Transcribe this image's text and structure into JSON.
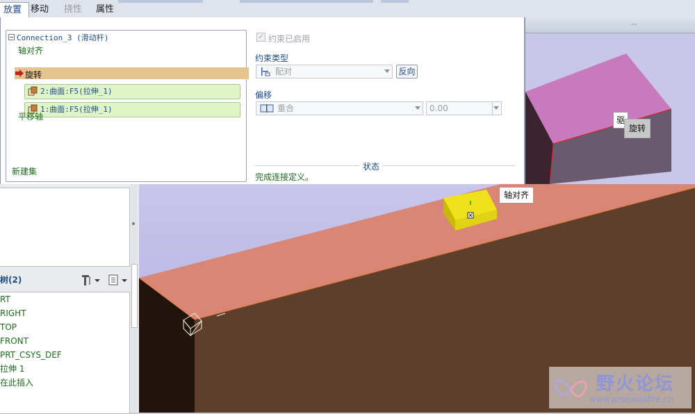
{
  "tabs": [
    {
      "label": "放置",
      "state": "active"
    },
    {
      "label": "移动",
      "state": "normal"
    },
    {
      "label": "挠性",
      "state": "disabled"
    },
    {
      "label": "属性",
      "state": "normal"
    }
  ],
  "sets": {
    "connection_title": "Connection_3 (滑动杆)",
    "items": [
      {
        "label": "轴对齐"
      },
      {
        "label": "旋转",
        "selected": true
      },
      {
        "label": "平移轴"
      }
    ],
    "references": [
      {
        "label": "2:曲面:F5(拉伸_1)"
      },
      {
        "label": "1:曲面:F5(拉伸_1)"
      }
    ],
    "new_set_label": "新建集"
  },
  "constraint": {
    "enabled_label": "约束已启用",
    "type_heading": "约束类型",
    "type_value": "配对",
    "flip_button": "反向",
    "offset_heading": "偏移",
    "offset_value": "重合",
    "offset_number": "0.00"
  },
  "status": {
    "heading": "状态",
    "message": "完成连接定义。"
  },
  "model_tree": {
    "section_title": "树(2)",
    "items": [
      "RT",
      "RIGHT",
      "TOP",
      "FRONT",
      "PRT_CSYS_DEF",
      "拉伸 1",
      "在此插入"
    ]
  },
  "viewport_labels": {
    "axis_align": "轴对齐",
    "rotate": "旋转",
    "preview_rotate": "旋转",
    "preview_partial": "驱"
  },
  "watermark": {
    "title": "野火论坛",
    "url": "www.proewildfire.cn"
  },
  "colors": {
    "beam_top": "#d98675",
    "beam_side": "#5e3f2c",
    "beam_end": "#20140c",
    "slider": "#f0e21a",
    "preview_top": "#c77bbd",
    "preview_side": "#6a5a6d"
  }
}
